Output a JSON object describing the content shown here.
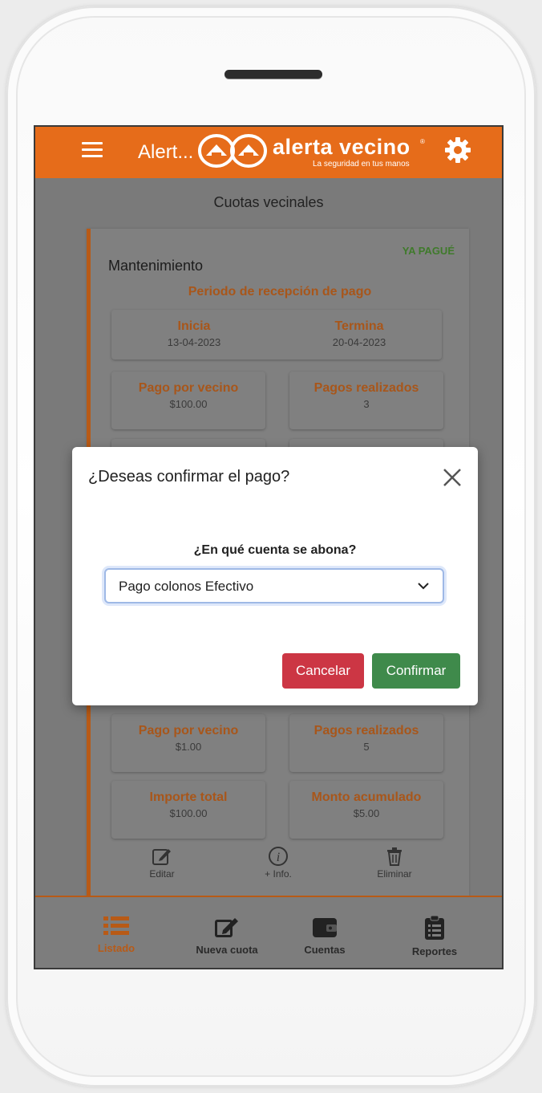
{
  "header": {
    "title": "Alert...",
    "brand": "alerta vecino",
    "brand_mark": "®",
    "tagline": "La seguridad en tus manos",
    "color": "#e66c1a"
  },
  "page": {
    "title": "Cuotas vecinales"
  },
  "card": {
    "paid_tag": "YA PAGUÉ",
    "name": "Mantenimiento",
    "period_label": "Periodo de recepción de pago",
    "start_label": "Inicia",
    "start_value": "13-04-2023",
    "end_label": "Termina",
    "end_value": "20-04-2023",
    "pay_per_neighbor_label": "Pago por vecino",
    "pay_per_neighbor_value": "$100.00",
    "payments_made_label": "Pagos realizados",
    "payments_made_value": "3"
  },
  "card2": {
    "pay_per_neighbor_label": "Pago por vecino",
    "pay_per_neighbor_value": "$1.00",
    "payments_made_label": "Pagos realizados",
    "payments_made_value": "5",
    "total_label": "Importe total",
    "total_value": "$100.00",
    "accumulated_label": "Monto acumulado",
    "accumulated_value": "$5.00",
    "actions": {
      "edit": "Editar",
      "info": "+ Info.",
      "delete": "Eliminar"
    }
  },
  "bottom_nav": {
    "items": [
      {
        "label": "Listado",
        "icon": "list-icon",
        "active": true
      },
      {
        "label": "Nueva cuota",
        "icon": "edit-icon",
        "active": false
      },
      {
        "label": "Cuentas",
        "icon": "wallet-icon",
        "active": false
      },
      {
        "label": "Reportes",
        "icon": "clipboard-icon",
        "active": false
      }
    ]
  },
  "modal": {
    "title": "¿Deseas confirmar el pago?",
    "question": "¿En qué cuenta se abona?",
    "account_selected": "Pago colonos Efectivo",
    "cancel_label": "Cancelar",
    "confirm_label": "Confirmar",
    "cancel_color": "#cc3644",
    "confirm_color": "#3f8a4b"
  }
}
